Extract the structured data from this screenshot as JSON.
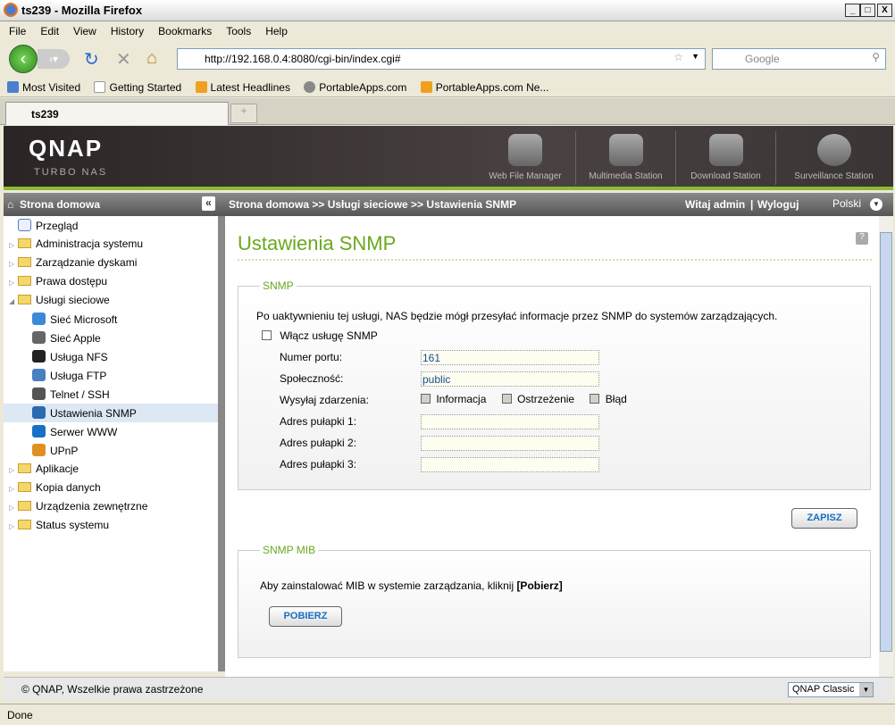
{
  "window": {
    "title": "ts239 - Mozilla Firefox",
    "min": "_",
    "max": "□",
    "close": "X"
  },
  "menu": [
    "File",
    "Edit",
    "View",
    "History",
    "Bookmarks",
    "Tools",
    "Help"
  ],
  "nav": {
    "url": "http://192.168.0.4:8080/cgi-bin/index.cgi#",
    "search_placeholder": "Google"
  },
  "bookmarks": [
    "Most Visited",
    "Getting Started",
    "Latest Headlines",
    "PortableApps.com",
    "PortableApps.com Ne..."
  ],
  "tab": {
    "label": "ts239",
    "new": "+"
  },
  "qnap": {
    "logo": "QNAP",
    "sub": "Turbo NAS",
    "apps": [
      "Web File Manager",
      "Multimedia Station",
      "Download Station",
      "Surveillance Station"
    ]
  },
  "subbar": {
    "home": "Strona domowa",
    "collapse": "«",
    "breadcrumb": "Strona domowa >> Usługi sieciowe >> Ustawienia SNMP",
    "welcome": "Witaj admin",
    "sep": "|",
    "logout": "Wyloguj",
    "lang": "Polski"
  },
  "sidebar": [
    {
      "label": "Przegląd",
      "level": 0,
      "icon": "overview-icon"
    },
    {
      "label": "Administracja systemu",
      "level": 0,
      "icon": "folder-icon",
      "tri": "▷"
    },
    {
      "label": "Zarządzanie dyskami",
      "level": 0,
      "icon": "folder-icon",
      "tri": "▷"
    },
    {
      "label": "Prawa dostępu",
      "level": 0,
      "icon": "folder-icon",
      "tri": "▷"
    },
    {
      "label": "Usługi sieciowe",
      "level": 0,
      "icon": "folder-open-icon",
      "tri": "◢"
    },
    {
      "label": "Sieć Microsoft",
      "level": 1,
      "icon": "windows-icon",
      "color": "#3a8ad8"
    },
    {
      "label": "Sieć Apple",
      "level": 1,
      "icon": "apple-icon",
      "color": "#666"
    },
    {
      "label": "Usługa NFS",
      "level": 1,
      "icon": "linux-icon",
      "color": "#222"
    },
    {
      "label": "Usługa FTP",
      "level": 1,
      "icon": "ftp-icon",
      "color": "#4a7fc0"
    },
    {
      "label": "Telnet / SSH",
      "level": 1,
      "icon": "terminal-icon",
      "color": "#555"
    },
    {
      "label": "Ustawienia SNMP",
      "level": 1,
      "icon": "snmp-icon",
      "color": "#2a6ab0",
      "selected": true
    },
    {
      "label": "Serwer WWW",
      "level": 1,
      "icon": "globe-icon",
      "color": "#1a70c8"
    },
    {
      "label": "UPnP",
      "level": 1,
      "icon": "upnp-icon",
      "color": "#e09020"
    },
    {
      "label": "Aplikacje",
      "level": 0,
      "icon": "folder-icon",
      "tri": "▷"
    },
    {
      "label": "Kopia danych",
      "level": 0,
      "icon": "folder-icon",
      "tri": "▷"
    },
    {
      "label": "Urządzenia zewnętrzne",
      "level": 0,
      "icon": "folder-icon",
      "tri": "▷"
    },
    {
      "label": "Status systemu",
      "level": 0,
      "icon": "folder-icon",
      "tri": "▷"
    }
  ],
  "main": {
    "title": "Ustawienia SNMP",
    "help": "?",
    "snmp": {
      "legend": "SNMP",
      "desc": "Po uaktywnieniu tej usługi, NAS będzie mógł przesyłać informacje przez SNMP do systemów zarządzających.",
      "enable_label": "Włącz usługę SNMP",
      "enable_checked": false,
      "port_label": "Numer portu:",
      "port": "161",
      "community_label": "Społeczność:",
      "community": "public",
      "events_label": "Wysyłaj zdarzenia:",
      "events": [
        {
          "label": "Informacja",
          "checked": false
        },
        {
          "label": "Ostrzeżenie",
          "checked": false
        },
        {
          "label": "Błąd",
          "checked": false
        }
      ],
      "trap1_label": "Adres pułapki 1:",
      "trap1": "",
      "trap2_label": "Adres pułapki 2:",
      "trap2": "",
      "trap3_label": "Adres pułapki 3:",
      "trap3": ""
    },
    "save": "ZAPISZ",
    "mib": {
      "legend": "SNMP MIB",
      "desc": "Aby zainstalować MIB w systemie zarządzania, kliknij ",
      "desc_bold": "[Pobierz]",
      "download": "POBIERZ"
    }
  },
  "footer": {
    "copyright": "© QNAP, Wszelkie prawa zastrzeżone",
    "theme": "QNAP Classic"
  },
  "status": "Done"
}
